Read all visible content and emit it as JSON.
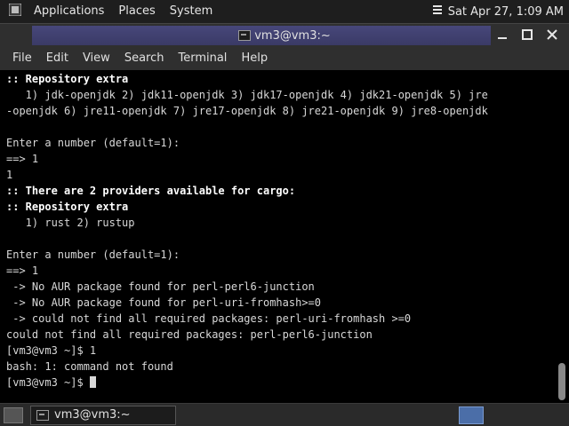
{
  "top_panel": {
    "menus": [
      "Applications",
      "Places",
      "System"
    ],
    "clock": "Sat Apr 27,  1:09 AM"
  },
  "window": {
    "title": "vm3@vm3:~",
    "menubar": [
      "File",
      "Edit",
      "View",
      "Search",
      "Terminal",
      "Help"
    ]
  },
  "terminal": {
    "lines": [
      ":: Repository extra",
      "   1) jdk-openjdk 2) jdk11-openjdk 3) jdk17-openjdk 4) jdk21-openjdk 5) jre",
      "-openjdk 6) jre11-openjdk 7) jre17-openjdk 8) jre21-openjdk 9) jre8-openjdk",
      "",
      "Enter a number (default=1):",
      "==> 1",
      "1",
      ":: There are 2 providers available for cargo:",
      ":: Repository extra",
      "   1) rust 2) rustup",
      "",
      "Enter a number (default=1):",
      "==> 1",
      " -> No AUR package found for perl-perl6-junction",
      " -> No AUR package found for perl-uri-fromhash>=0",
      " -> could not find all required packages: perl-uri-fromhash >=0",
      "could not find all required packages: perl-perl6-junction",
      "[vm3@vm3 ~]$ 1",
      "bash: 1: command not found",
      "[vm3@vm3 ~]$ "
    ]
  },
  "taskbar": {
    "task_label": "vm3@vm3:~"
  }
}
